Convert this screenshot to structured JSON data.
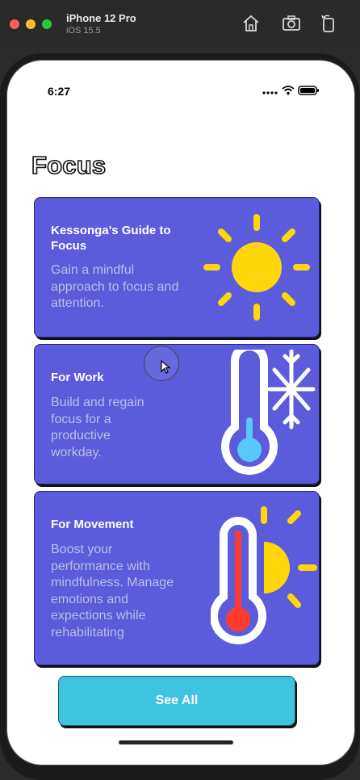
{
  "simulator": {
    "device_name": "iPhone 12 Pro",
    "os_version": "iOS 15.5",
    "icons": [
      "home-icon",
      "screenshot-icon",
      "rotate-icon"
    ]
  },
  "status_bar": {
    "time": "6:27",
    "icons": [
      "signal-icon",
      "wifi-icon",
      "battery-icon"
    ]
  },
  "page": {
    "title": "Focus"
  },
  "cards": [
    {
      "title": "Kessonga's Guide to Focus",
      "description": "Gain a mindful approach to focus and attention.",
      "art": "sun-icon"
    },
    {
      "title": "For Work",
      "description": "Build and regain focus for a productive workday.",
      "art": "thermometer-snowflake-icon"
    },
    {
      "title": "For Movement",
      "description": "Boost your performance with mindfulness. Manage emotions and expections while rehabilitating",
      "art": "thermometer-sun-icon"
    }
  ],
  "see_all_label": "See All",
  "colors": {
    "card": "#5b5bdc",
    "button": "#3ec4de",
    "sun": "#ffd60a",
    "cold": "#5ac8fa",
    "hot": "#ff3b30"
  }
}
